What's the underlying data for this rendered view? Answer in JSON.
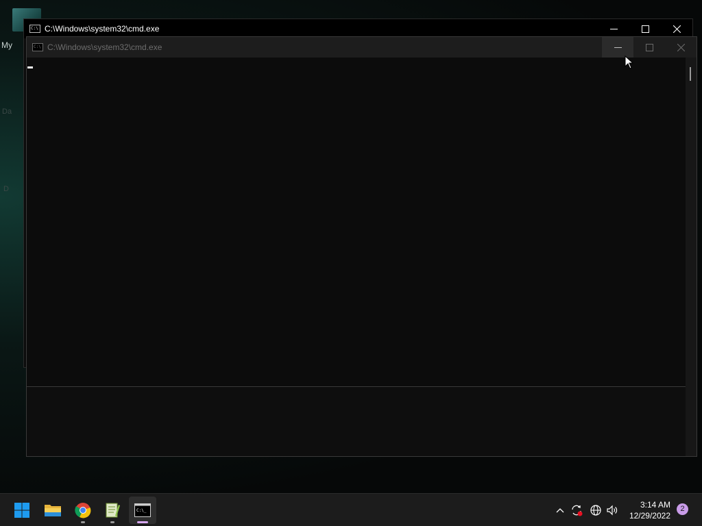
{
  "desktop": {
    "label_my": "My",
    "label_da": "Da",
    "label_d": "D"
  },
  "back_window": {
    "title": "C:\\Windows\\system32\\cmd.exe",
    "icon_glyph": "C:\\"
  },
  "front_window": {
    "title": "C:\\Windows\\system32\\cmd.exe",
    "icon_glyph": "C:\\"
  },
  "taskbar": {
    "apps": [
      {
        "name": "start",
        "icon": "windows-logo-icon"
      },
      {
        "name": "file-explorer",
        "icon": "folder-icon"
      },
      {
        "name": "chrome",
        "icon": "chrome-icon"
      },
      {
        "name": "notepad-plus",
        "icon": "notepad-icon"
      },
      {
        "name": "cmd",
        "icon": "terminal-icon"
      }
    ],
    "time": "3:14 AM",
    "date": "12/29/2022",
    "notification_count": "2"
  },
  "colors": {
    "accent": "#c99ce8",
    "console_bg": "#0c0c0c",
    "taskbar_bg": "#1c1c1c"
  }
}
